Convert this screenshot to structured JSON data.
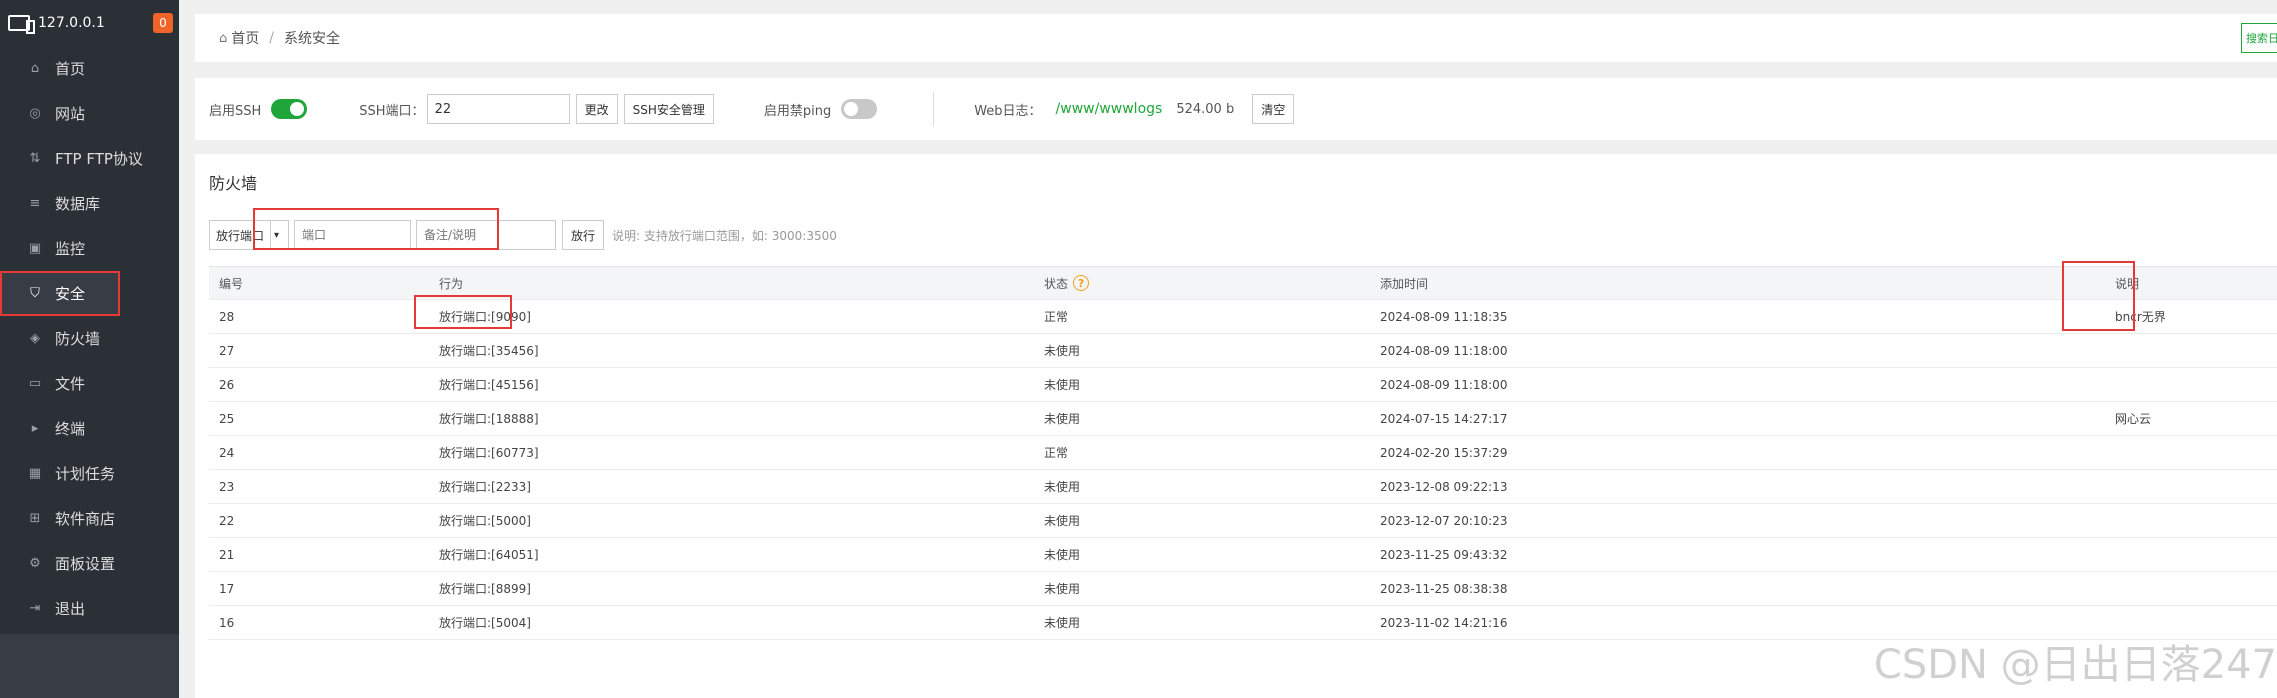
{
  "sidebar": {
    "host": "127.0.0.1",
    "badge": "0",
    "items": [
      {
        "label": "首页",
        "icon": "home-icon"
      },
      {
        "label": "网站",
        "icon": "globe-icon"
      },
      {
        "label": "FTP FTP协议",
        "icon": "ftp-icon"
      },
      {
        "label": "数据库",
        "icon": "database-icon"
      },
      {
        "label": "监控",
        "icon": "monitor-icon"
      },
      {
        "label": "安全",
        "icon": "shield-icon"
      },
      {
        "label": "防火墙",
        "icon": "firewall-icon"
      },
      {
        "label": "文件",
        "icon": "folder-icon"
      },
      {
        "label": "终端",
        "icon": "terminal-icon"
      },
      {
        "label": "计划任务",
        "icon": "calendar-icon"
      },
      {
        "label": "软件商店",
        "icon": "grid-icon"
      },
      {
        "label": "面板设置",
        "icon": "gear-icon"
      },
      {
        "label": "退出",
        "icon": "logout-icon"
      }
    ],
    "active_index": 5
  },
  "breadcrumb": {
    "home": "首页",
    "separator": "/",
    "current": "系统安全",
    "search_button": "搜索日"
  },
  "ssh": {
    "enable_label": "启用SSH",
    "port_label": "SSH端口：",
    "port_value": "22",
    "change_button": "更改",
    "manage_button": "SSH安全管理",
    "ping_label": "启用禁ping",
    "weblog_label": "Web日志：",
    "weblog_path": "/www/wwwlogs",
    "weblog_size": "524.00 b",
    "clear_button": "清空"
  },
  "firewall": {
    "title": "防火墙",
    "select_value": "放行端口",
    "port_placeholder": "端口",
    "note_placeholder": "备注/说明",
    "allow_button": "放行",
    "hint": "说明: 支持放行端口范围，如: 3000:3500",
    "columns": [
      "编号",
      "行为",
      "状态",
      "添加时间",
      "说明"
    ],
    "rows": [
      {
        "id": "28",
        "action": "放行端口:[9090]",
        "status": "正常",
        "time": "2024-08-09 11:18:35",
        "note": "bncr无界"
      },
      {
        "id": "27",
        "action": "放行端口:[35456]",
        "status": "未使用",
        "time": "2024-08-09 11:18:00",
        "note": ""
      },
      {
        "id": "26",
        "action": "放行端口:[45156]",
        "status": "未使用",
        "time": "2024-08-09 11:18:00",
        "note": ""
      },
      {
        "id": "25",
        "action": "放行端口:[18888]",
        "status": "未使用",
        "time": "2024-07-15 14:27:17",
        "note": "网心云"
      },
      {
        "id": "24",
        "action": "放行端口:[60773]",
        "status": "正常",
        "time": "2024-02-20 15:37:29",
        "note": ""
      },
      {
        "id": "23",
        "action": "放行端口:[2233]",
        "status": "未使用",
        "time": "2023-12-08 09:22:13",
        "note": ""
      },
      {
        "id": "22",
        "action": "放行端口:[5000]",
        "status": "未使用",
        "time": "2023-12-07 20:10:23",
        "note": ""
      },
      {
        "id": "21",
        "action": "放行端口:[64051]",
        "status": "未使用",
        "time": "2023-11-25 09:43:32",
        "note": ""
      },
      {
        "id": "17",
        "action": "放行端口:[8899]",
        "status": "未使用",
        "time": "2023-11-25 08:38:38",
        "note": ""
      },
      {
        "id": "16",
        "action": "放行端口:[5004]",
        "status": "未使用",
        "time": "2023-11-02 14:21:16",
        "note": ""
      }
    ]
  },
  "watermark": "CSDN @日出日落247",
  "colors": {
    "accent": "#20a53a",
    "highlight": "#e53935",
    "sidebar": "#2b2f36"
  }
}
